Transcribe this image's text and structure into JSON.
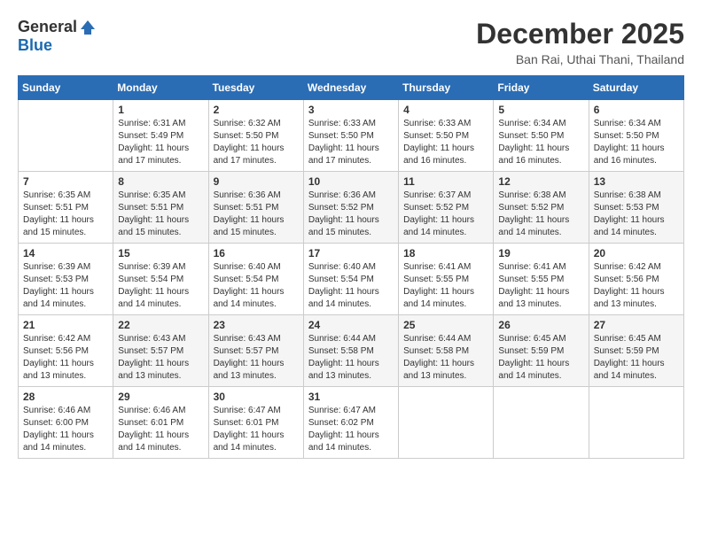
{
  "logo": {
    "general": "General",
    "blue": "Blue"
  },
  "title": {
    "month_year": "December 2025",
    "location": "Ban Rai, Uthai Thani, Thailand"
  },
  "headers": [
    "Sunday",
    "Monday",
    "Tuesday",
    "Wednesday",
    "Thursday",
    "Friday",
    "Saturday"
  ],
  "weeks": [
    [
      {
        "num": "",
        "info": ""
      },
      {
        "num": "1",
        "info": "Sunrise: 6:31 AM\nSunset: 5:49 PM\nDaylight: 11 hours\nand 17 minutes."
      },
      {
        "num": "2",
        "info": "Sunrise: 6:32 AM\nSunset: 5:50 PM\nDaylight: 11 hours\nand 17 minutes."
      },
      {
        "num": "3",
        "info": "Sunrise: 6:33 AM\nSunset: 5:50 PM\nDaylight: 11 hours\nand 17 minutes."
      },
      {
        "num": "4",
        "info": "Sunrise: 6:33 AM\nSunset: 5:50 PM\nDaylight: 11 hours\nand 16 minutes."
      },
      {
        "num": "5",
        "info": "Sunrise: 6:34 AM\nSunset: 5:50 PM\nDaylight: 11 hours\nand 16 minutes."
      },
      {
        "num": "6",
        "info": "Sunrise: 6:34 AM\nSunset: 5:50 PM\nDaylight: 11 hours\nand 16 minutes."
      }
    ],
    [
      {
        "num": "7",
        "info": "Sunrise: 6:35 AM\nSunset: 5:51 PM\nDaylight: 11 hours\nand 15 minutes."
      },
      {
        "num": "8",
        "info": "Sunrise: 6:35 AM\nSunset: 5:51 PM\nDaylight: 11 hours\nand 15 minutes."
      },
      {
        "num": "9",
        "info": "Sunrise: 6:36 AM\nSunset: 5:51 PM\nDaylight: 11 hours\nand 15 minutes."
      },
      {
        "num": "10",
        "info": "Sunrise: 6:36 AM\nSunset: 5:52 PM\nDaylight: 11 hours\nand 15 minutes."
      },
      {
        "num": "11",
        "info": "Sunrise: 6:37 AM\nSunset: 5:52 PM\nDaylight: 11 hours\nand 14 minutes."
      },
      {
        "num": "12",
        "info": "Sunrise: 6:38 AM\nSunset: 5:52 PM\nDaylight: 11 hours\nand 14 minutes."
      },
      {
        "num": "13",
        "info": "Sunrise: 6:38 AM\nSunset: 5:53 PM\nDaylight: 11 hours\nand 14 minutes."
      }
    ],
    [
      {
        "num": "14",
        "info": "Sunrise: 6:39 AM\nSunset: 5:53 PM\nDaylight: 11 hours\nand 14 minutes."
      },
      {
        "num": "15",
        "info": "Sunrise: 6:39 AM\nSunset: 5:54 PM\nDaylight: 11 hours\nand 14 minutes."
      },
      {
        "num": "16",
        "info": "Sunrise: 6:40 AM\nSunset: 5:54 PM\nDaylight: 11 hours\nand 14 minutes."
      },
      {
        "num": "17",
        "info": "Sunrise: 6:40 AM\nSunset: 5:54 PM\nDaylight: 11 hours\nand 14 minutes."
      },
      {
        "num": "18",
        "info": "Sunrise: 6:41 AM\nSunset: 5:55 PM\nDaylight: 11 hours\nand 14 minutes."
      },
      {
        "num": "19",
        "info": "Sunrise: 6:41 AM\nSunset: 5:55 PM\nDaylight: 11 hours\nand 13 minutes."
      },
      {
        "num": "20",
        "info": "Sunrise: 6:42 AM\nSunset: 5:56 PM\nDaylight: 11 hours\nand 13 minutes."
      }
    ],
    [
      {
        "num": "21",
        "info": "Sunrise: 6:42 AM\nSunset: 5:56 PM\nDaylight: 11 hours\nand 13 minutes."
      },
      {
        "num": "22",
        "info": "Sunrise: 6:43 AM\nSunset: 5:57 PM\nDaylight: 11 hours\nand 13 minutes."
      },
      {
        "num": "23",
        "info": "Sunrise: 6:43 AM\nSunset: 5:57 PM\nDaylight: 11 hours\nand 13 minutes."
      },
      {
        "num": "24",
        "info": "Sunrise: 6:44 AM\nSunset: 5:58 PM\nDaylight: 11 hours\nand 13 minutes."
      },
      {
        "num": "25",
        "info": "Sunrise: 6:44 AM\nSunset: 5:58 PM\nDaylight: 11 hours\nand 13 minutes."
      },
      {
        "num": "26",
        "info": "Sunrise: 6:45 AM\nSunset: 5:59 PM\nDaylight: 11 hours\nand 14 minutes."
      },
      {
        "num": "27",
        "info": "Sunrise: 6:45 AM\nSunset: 5:59 PM\nDaylight: 11 hours\nand 14 minutes."
      }
    ],
    [
      {
        "num": "28",
        "info": "Sunrise: 6:46 AM\nSunset: 6:00 PM\nDaylight: 11 hours\nand 14 minutes."
      },
      {
        "num": "29",
        "info": "Sunrise: 6:46 AM\nSunset: 6:01 PM\nDaylight: 11 hours\nand 14 minutes."
      },
      {
        "num": "30",
        "info": "Sunrise: 6:47 AM\nSunset: 6:01 PM\nDaylight: 11 hours\nand 14 minutes."
      },
      {
        "num": "31",
        "info": "Sunrise: 6:47 AM\nSunset: 6:02 PM\nDaylight: 11 hours\nand 14 minutes."
      },
      {
        "num": "",
        "info": ""
      },
      {
        "num": "",
        "info": ""
      },
      {
        "num": "",
        "info": ""
      }
    ]
  ]
}
